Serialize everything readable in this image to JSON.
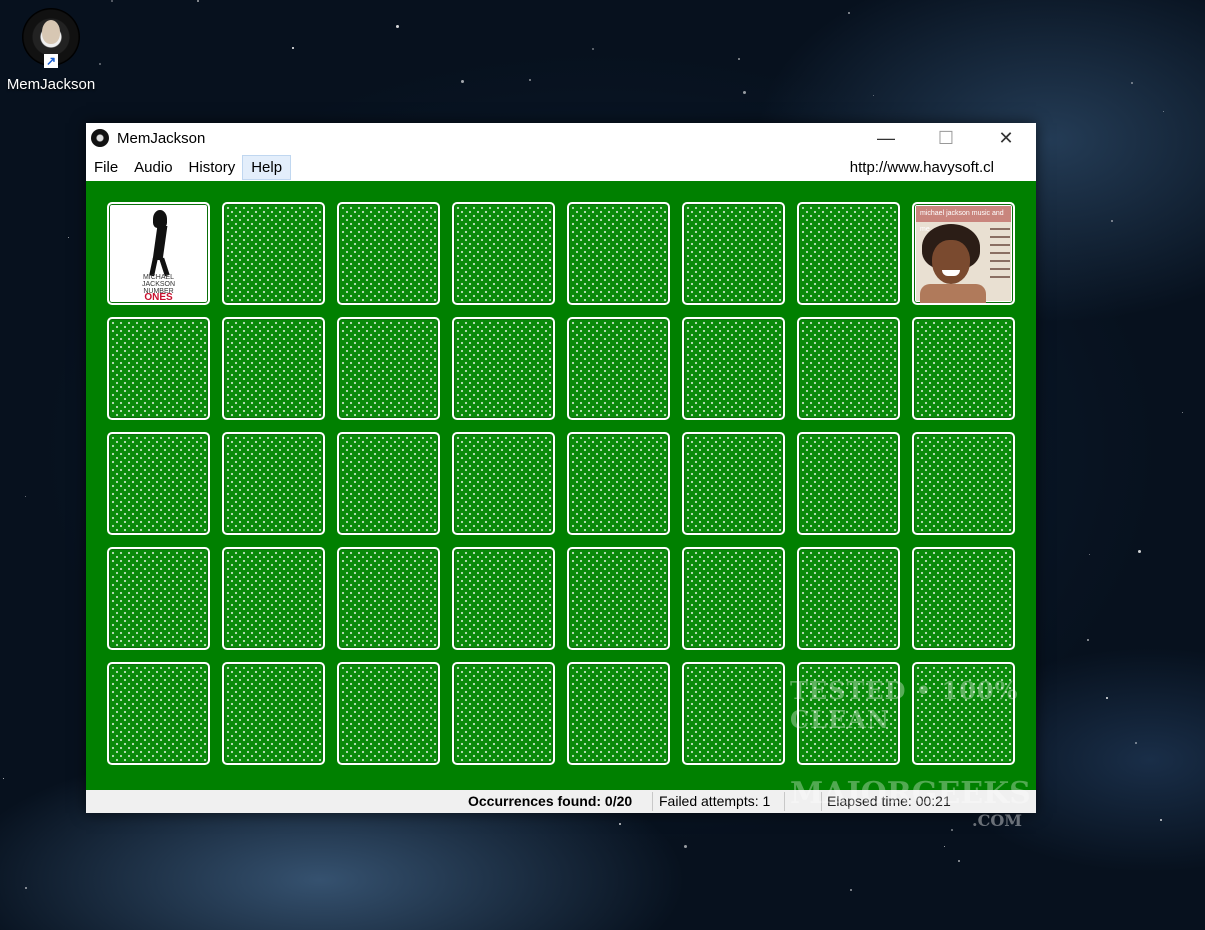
{
  "desktop": {
    "icon_label": "MemJackson"
  },
  "window": {
    "title": "MemJackson",
    "controls": {
      "minimize": "—",
      "maximize": "☐",
      "close": "✕"
    }
  },
  "menu": {
    "items": [
      "File",
      "Audio",
      "History",
      "Help"
    ],
    "active": "Help",
    "url": "http://www.havysoft.cl"
  },
  "board": {
    "rows": 5,
    "cols": 8,
    "face_up": [
      {
        "position": 0,
        "album": "Number Ones",
        "lines": [
          "MICHAEL",
          "JACKSON",
          "NUMBER"
        ],
        "highlight": "ONES"
      },
      {
        "position": 7,
        "album": "Music and Me",
        "band_text": "michael jackson  music and me"
      }
    ],
    "colors": {
      "felt": "#008000",
      "card_border": "#ffffff"
    }
  },
  "status": {
    "found": "Occurrences found: 0/20",
    "failed": "Failed attempts: 1",
    "elapsed": "Elapsed time: 00:21"
  },
  "watermark": {
    "line1": "TESTED • 100% CLEAN",
    "line2": "MAJORGEEKS",
    "line3": ".COM"
  }
}
